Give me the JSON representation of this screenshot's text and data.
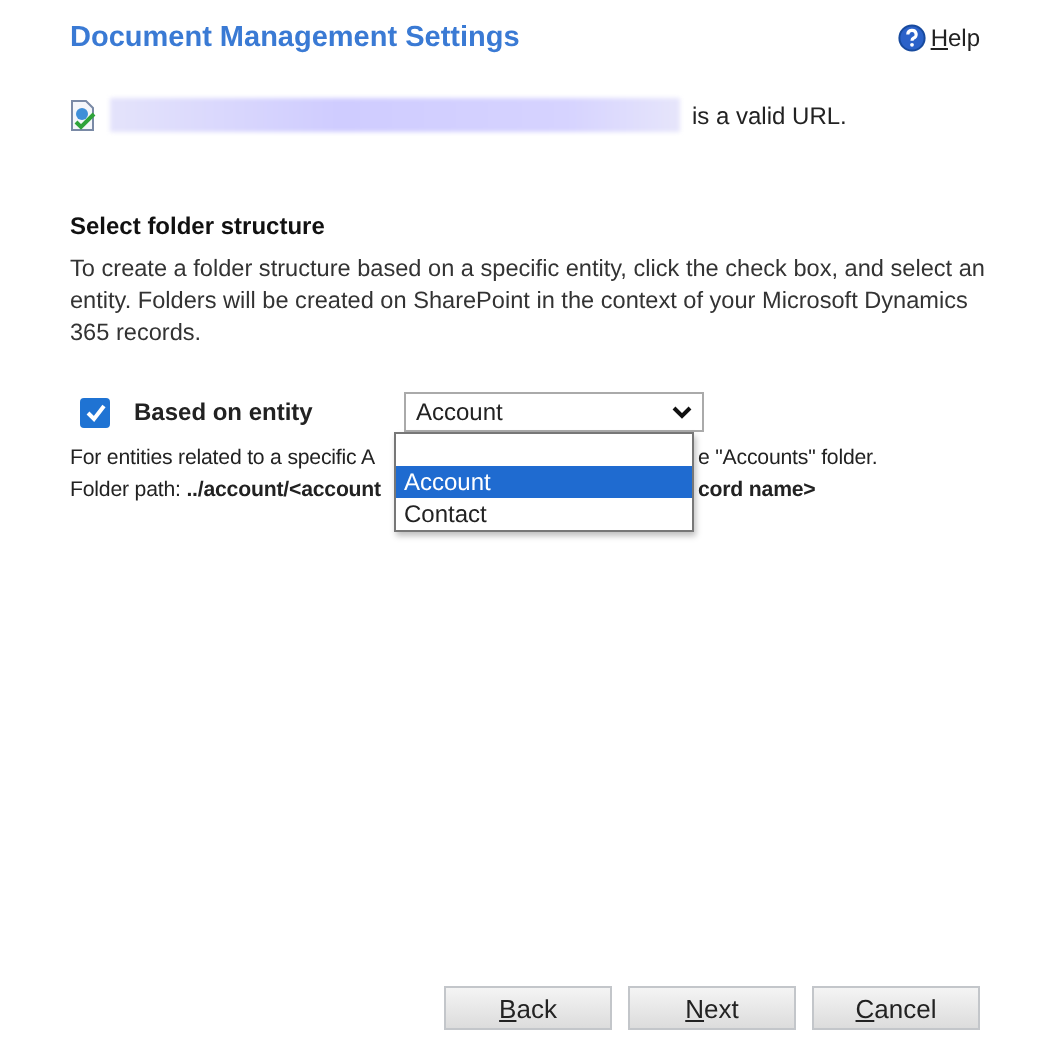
{
  "header": {
    "title": "Document Management Settings",
    "help": "Help"
  },
  "url_check": {
    "message": "is a valid URL."
  },
  "folder_structure": {
    "heading": "Select folder structure",
    "description": "To create a folder structure based on a specific entity, click the check box, and select an entity. Folders will be created on SharePoint in the context of your Microsoft Dynamics 365 records.",
    "based_on_entity": {
      "label": "Based on entity",
      "checked": true
    },
    "entity_select": {
      "value": "Account",
      "expanded": true,
      "options": [
        {
          "kind": "option",
          "label": "Account",
          "selected": true
        },
        {
          "kind": "option",
          "label": "Contact",
          "selected": false
        }
      ]
    },
    "note_lines": [
      {
        "left": "For entities related to a specific A",
        "right": "e \"Accounts\" folder."
      },
      {
        "left": "Folder path: **../account/<account**",
        "right": "**cord name>**"
      }
    ]
  },
  "buttons": [
    {
      "label": "Back"
    },
    {
      "label": "Next"
    },
    {
      "label": "Cancel"
    }
  ]
}
